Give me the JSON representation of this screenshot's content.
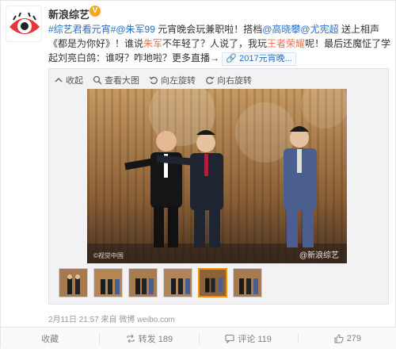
{
  "account": {
    "name": "新浪综艺",
    "verified_badge": "V"
  },
  "post": {
    "hashtag": "#综艺君看元宵#",
    "mention_1": "@朱军99",
    "text_1": " 元宵晚会玩兼职啦！搭档",
    "mention_2": "@高晓攀",
    "mention_3": "@尤宪超",
    "text_2": " 送上相声《都是为你好》！谁说",
    "highlight_1": "朱军",
    "text_3": "不年轻了？人说了，我玩",
    "highlight_2": "王者荣耀",
    "text_4": "呢！最后还魔怔了学起刘亮白鸽：谁呀？咋地啦？更多直播→",
    "short_link": "2017元宵晚..."
  },
  "media": {
    "toolbar": {
      "collapse": "收起",
      "view_large": "查看大图",
      "rotate_left": "向左旋转",
      "rotate_right": "向右旋转"
    },
    "watermark_left": "©视觉中国",
    "watermark_right": "@新浪综艺",
    "thumb_count": 6,
    "active_thumb_index": 4
  },
  "meta": {
    "timestamp": "2月11日 21:57",
    "source_prefix": "来自",
    "source": "微博 weibo.com"
  },
  "actions": {
    "collect": "收藏",
    "repost": "转发 189",
    "comment": "评论 119",
    "like": "279"
  },
  "colors": {
    "accent": "#eb7350",
    "link": "#2a6fc9",
    "active_thumb": "#f29100"
  }
}
